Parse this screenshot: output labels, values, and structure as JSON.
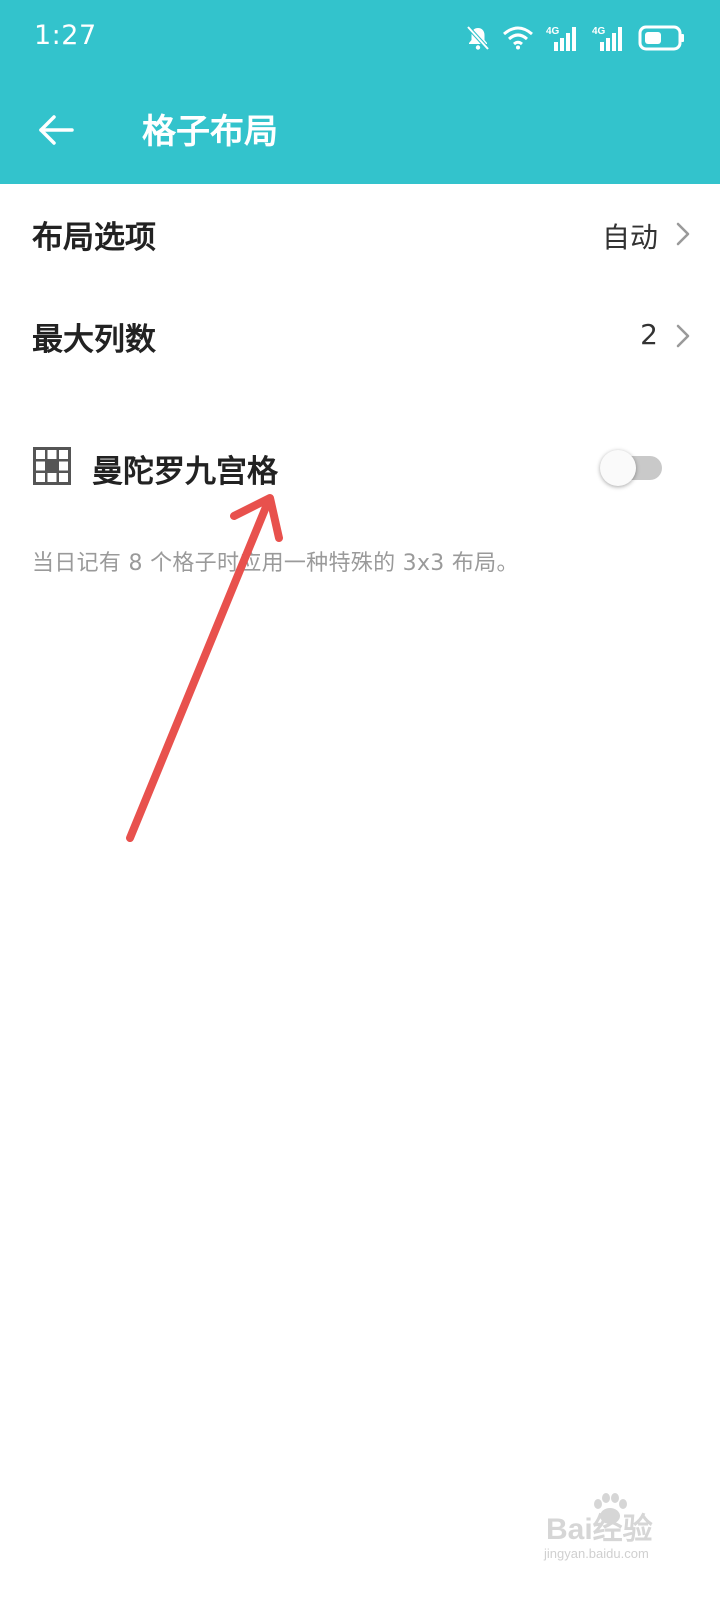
{
  "status_bar": {
    "time": "1:27",
    "icons": [
      "bell-muted-icon",
      "wifi-icon",
      "signal-4g-icon",
      "signal-4g-icon",
      "battery-icon"
    ],
    "network_labels": [
      "4G",
      "4G"
    ]
  },
  "app_bar": {
    "title": "格子布局",
    "background": "#33c3cc",
    "back_icon": "arrow-left-icon"
  },
  "settings": [
    {
      "label": "布局选项",
      "value": "自动"
    },
    {
      "label": "最大列数",
      "value": "2"
    }
  ],
  "mandala": {
    "label": "曼陀罗九宫格",
    "icon": "grid-3x3-icon",
    "enabled": false,
    "description": "当日记有 8 个格子时应用一种特殊的 3x3 布局。"
  },
  "annotation": {
    "color": "#e8514d"
  },
  "watermark": {
    "main": "Bai经验",
    "sub": "jingyan.baidu.com"
  }
}
